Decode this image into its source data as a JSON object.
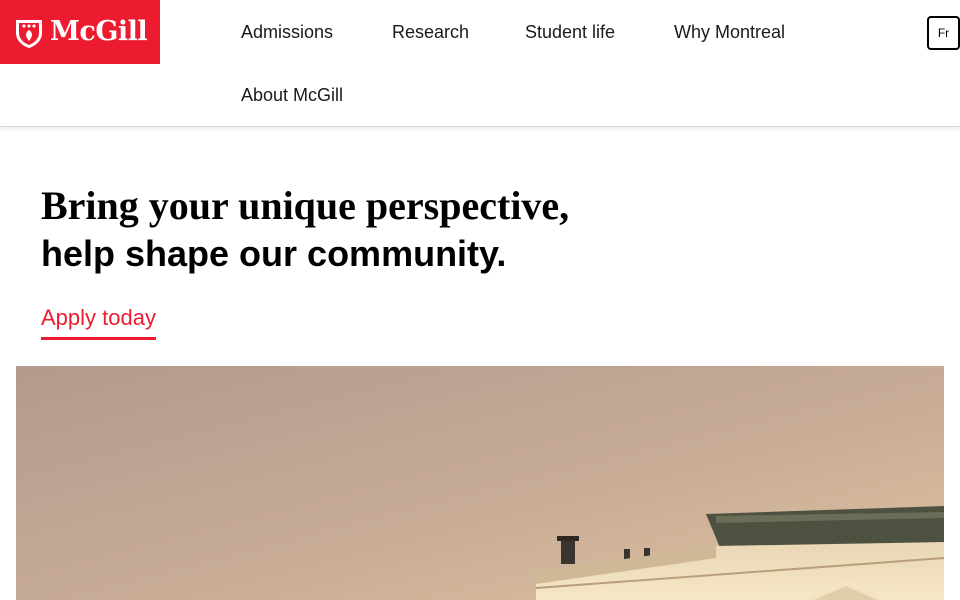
{
  "brand": {
    "wordmark": "McGill",
    "accent_color": "#ed1b2f"
  },
  "header": {
    "nav": [
      {
        "label": "Admissions"
      },
      {
        "label": "Research"
      },
      {
        "label": "Student life"
      },
      {
        "label": "Why Montreal"
      },
      {
        "label": "About McGill"
      }
    ],
    "language_toggle": "Fr"
  },
  "hero": {
    "line1": "Bring your unique perspective,",
    "line2": "help shape our community.",
    "cta_label": "Apply today"
  },
  "hero_image": {
    "alt_subject": "historic stone building rooftop at sunset",
    "icon": "building-photo"
  }
}
